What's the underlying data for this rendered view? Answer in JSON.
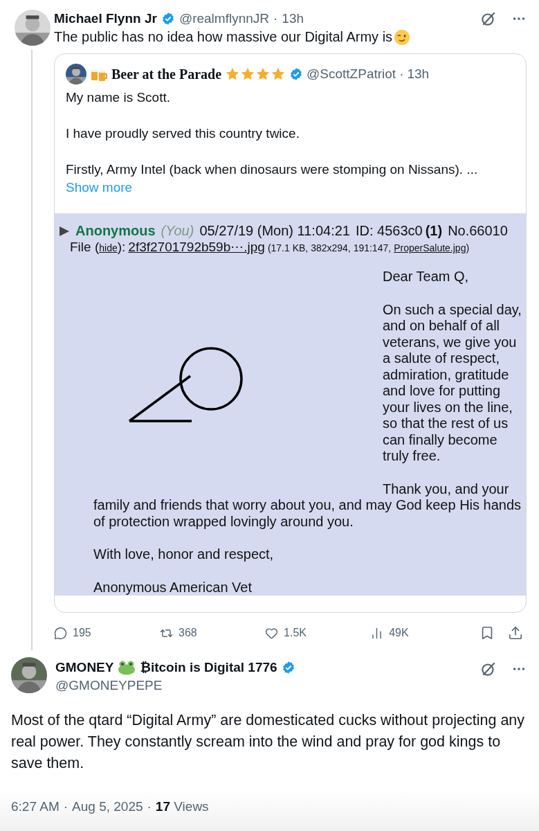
{
  "thread_tweet": {
    "author": {
      "name": "Michael Flynn Jr",
      "verified": true,
      "handle": "@realmflynnJR",
      "separator": "·",
      "time": "13h"
    },
    "text": "The public has no idea how massive our Digital Army is",
    "quote": {
      "author": {
        "name": "Beer at the Parade",
        "stars": 4,
        "verified": true,
        "handle": "@ScottZPatriot",
        "separator": "·",
        "time": "13h"
      },
      "paragraphs": [
        "My name is Scott.",
        "I have proudly served this country twice.",
        "Firstly, Army Intel (back when dinosaurs were stomping on Nissans). ..."
      ],
      "show_more": "Show more",
      "image": {
        "post": {
          "name": "Anonymous",
          "you": "(You)",
          "date": "05/27/19 (Mon) 11:04:21",
          "id": "ID: 4563c0",
          "replies": "(1)",
          "number": "No.66010",
          "file_prefix": "File (",
          "hide": "hide",
          "file_mid": "):",
          "file_link": "2f3f2701792b59b⋯.jpg",
          "file_info": "(17.1 KB, 382x294, 191:147,",
          "original_name": "ProperSalute.jpg",
          "file_end": ")"
        },
        "letter_column": [
          "Dear Team Q,",
          "On such a special day, and on behalf of all veterans, we give you a salute of respect, admiration, gratitude and love for putting your lives on the line, so that the rest of us can finally become truly free.",
          "Thank you, and your"
        ],
        "letter_full": [
          "family and friends that worry about you, and may God keep His hands of protection wrapped lovingly around you.",
          "With love, honor and respect,",
          "Anonymous American Vet"
        ]
      }
    },
    "actions": [
      {
        "kind": "reply",
        "count": "195"
      },
      {
        "kind": "repost",
        "count": "368"
      },
      {
        "kind": "like",
        "count": "1.5K"
      },
      {
        "kind": "views",
        "count": "49K"
      },
      {
        "kind": "bookmark"
      },
      {
        "kind": "share"
      }
    ]
  },
  "reply": {
    "author": {
      "name": "GMONEY",
      "name_suffix": "₿itcoin is Digital 1776",
      "verified": true,
      "handle": "@GMONEYPEPE"
    },
    "text": "Most of the qtard “Digital Army” are domesticated cucks without projecting any real power. They constantly scream into the wind and pray for god kings to save them."
  },
  "footer": {
    "time": "6:27 AM",
    "separator": "·",
    "date": "Aug 5, 2025",
    "separator_2": "·",
    "views_count": "17",
    "views_label": "Views"
  }
}
